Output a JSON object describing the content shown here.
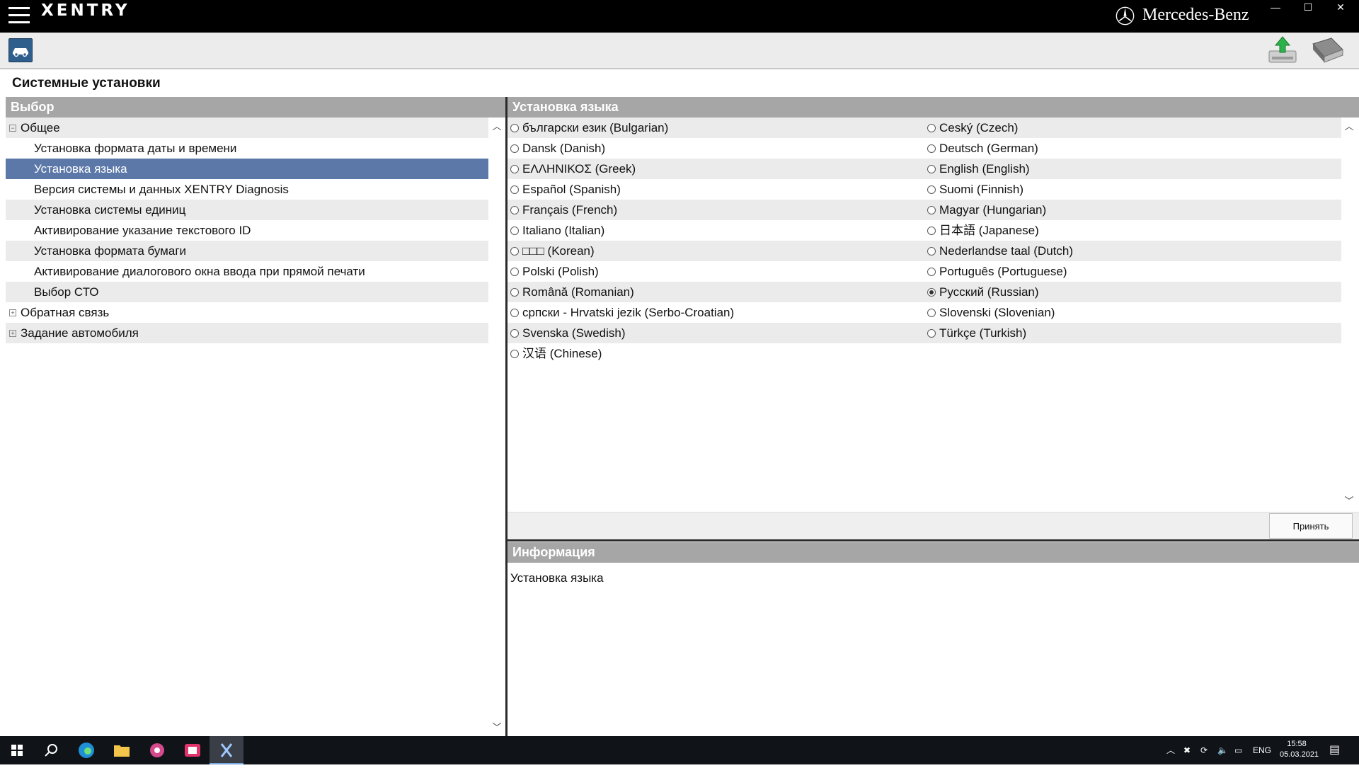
{
  "app": {
    "logo": "XENTRY",
    "brand": "Mercedes-Benz"
  },
  "page_title": "Системные установки",
  "left_panel": {
    "header": "Выбор",
    "items": [
      {
        "label": "Общее",
        "level": 0,
        "expander": "⊟",
        "selected": false
      },
      {
        "label": "Установка формата даты и времени",
        "level": 1,
        "selected": false
      },
      {
        "label": "Установка языка",
        "level": 1,
        "selected": true
      },
      {
        "label": "Версия системы и данных XENTRY Diagnosis",
        "level": 1,
        "selected": false
      },
      {
        "label": "Установка системы единиц",
        "level": 1,
        "selected": false
      },
      {
        "label": "Активирование указание текстового ID",
        "level": 1,
        "selected": false
      },
      {
        "label": "Установка формата бумаги",
        "level": 1,
        "selected": false
      },
      {
        "label": "Активирование диалогового окна ввода при прямой печати",
        "level": 1,
        "selected": false
      },
      {
        "label": "Выбор СТО",
        "level": 1,
        "selected": false
      },
      {
        "label": "Обратная связь",
        "level": 0,
        "expander": "⊞",
        "selected": false
      },
      {
        "label": "Задание автомобиля",
        "level": 0,
        "expander": "⊞",
        "selected": false
      }
    ]
  },
  "language_panel": {
    "header": "Установка языка",
    "rows": [
      [
        "български език (Bulgarian)",
        "Ceský (Czech)"
      ],
      [
        "Dansk (Danish)",
        "Deutsch (German)"
      ],
      [
        "ΕΛΛΗΝΙΚΟΣ (Greek)",
        "English (English)"
      ],
      [
        "Español (Spanish)",
        "Suomi (Finnish)"
      ],
      [
        "Français (French)",
        "Magyar (Hungarian)"
      ],
      [
        "Italiano (Italian)",
        "日本語 (Japanese)"
      ],
      [
        "□□□ (Korean)",
        "Nederlandse taal (Dutch)"
      ],
      [
        "Polski (Polish)",
        "Português (Portuguese)"
      ],
      [
        "Română (Romanian)",
        "Русский (Russian)"
      ],
      [
        "српски - Hrvatski jezik (Serbo-Croatian)",
        "Slovenski (Slovenian)"
      ],
      [
        "Svenska (Swedish)",
        "Türkçe (Turkish)"
      ],
      [
        "汉语 (Chinese)",
        ""
      ]
    ],
    "selected": "Русский (Russian)",
    "accept_label": "Принять"
  },
  "info_panel": {
    "header": "Информация",
    "text": "Установка языка"
  },
  "taskbar": {
    "language": "ENG",
    "time": "15:58",
    "date": "05.03.2021"
  },
  "colors": {
    "titlebar": "#000000",
    "panel_header": "#a6a6a6",
    "selection": "#5b78a8",
    "row_alt": "#ebebeb"
  },
  "icons": [
    "hamburger-icon",
    "car-icon",
    "upload-icon",
    "book-icon",
    "windows-icon",
    "search-icon",
    "edge-icon",
    "folder-icon"
  ]
}
